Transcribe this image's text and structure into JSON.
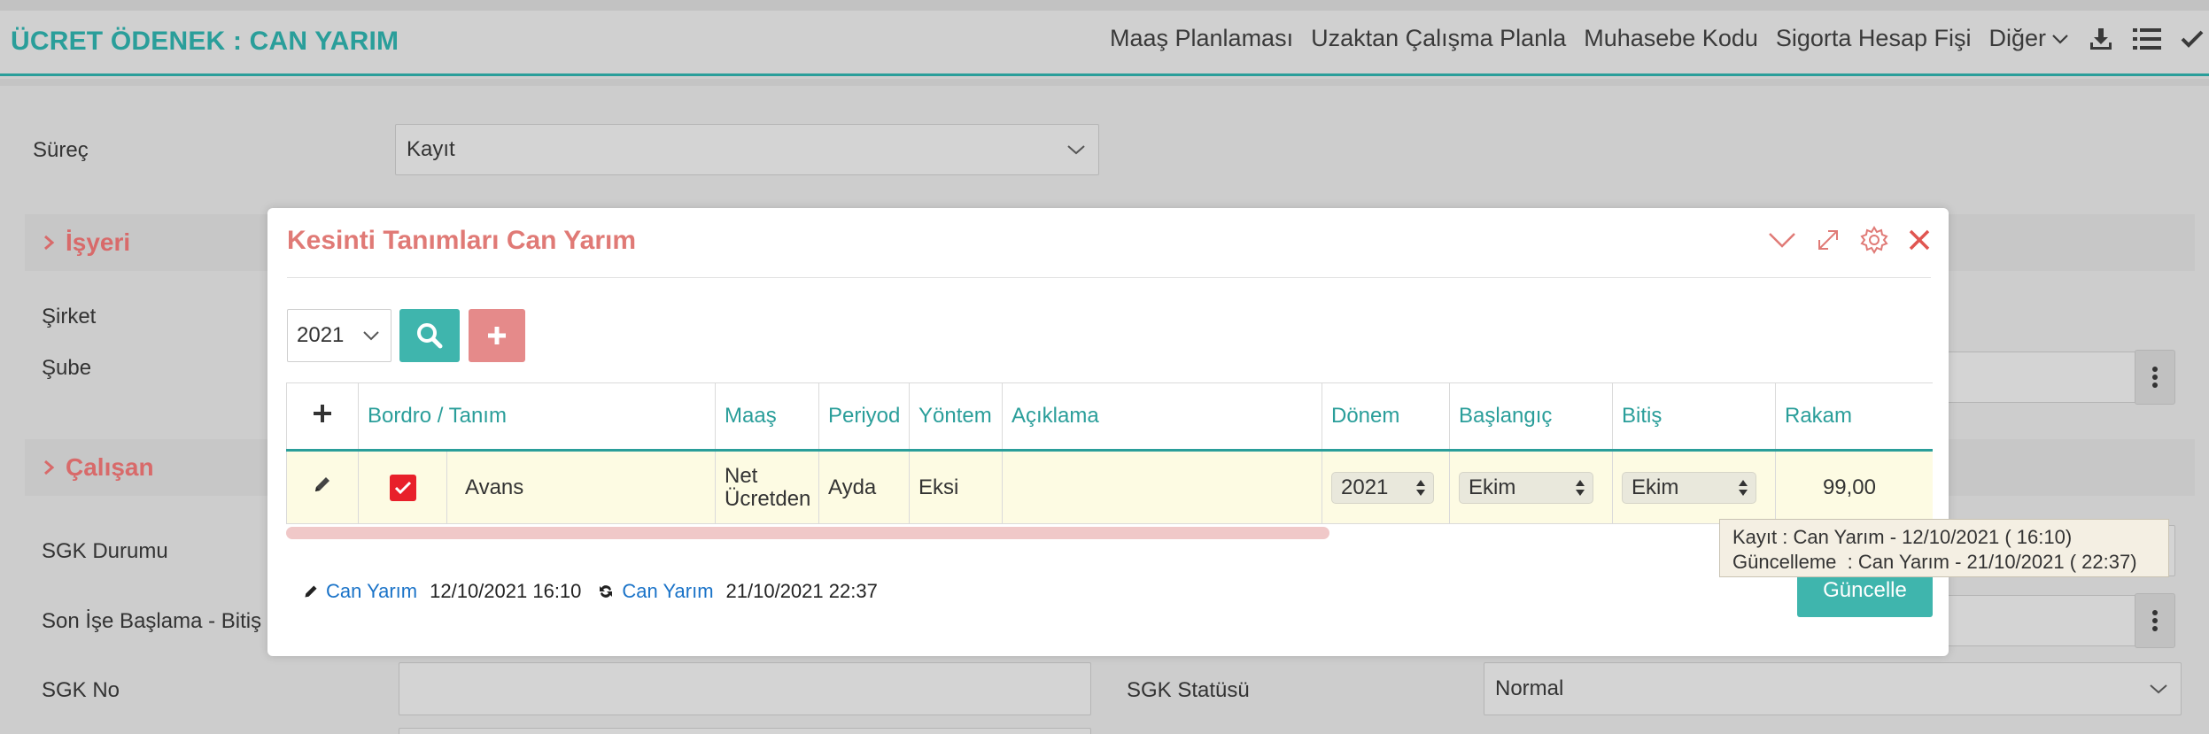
{
  "header": {
    "title": "ÜCRET ÖDENEK : CAN YARIM",
    "nav": [
      "Maaş Planlaması",
      "Uzaktan Çalışma Planla",
      "Muhasebe Kodu",
      "Sigorta Hesap Fişi"
    ],
    "more_label": "Diğer",
    "icons": [
      "download-icon",
      "list-icon",
      "check-icon"
    ]
  },
  "form": {
    "surec_label": "Süreç",
    "surec_value": "Kayıt",
    "isyeri_section": "İşyeri",
    "sirket_label": "Şirket",
    "sube_label": "Şube",
    "calisan_section": "Çalışan",
    "sgk_durumu_label": "SGK Durumu",
    "son_ise_label": "Son İşe Başlama - Bitiş",
    "sgk_no_label": "SGK No",
    "sgk_statusu_label": "SGK Statüsü",
    "sgk_statusu_value": "Normal"
  },
  "modal": {
    "title": "Kesinti Tanımları Can Yarım",
    "year": "2021",
    "columns": {
      "add": "+",
      "bordro": "Bordro / Tanım",
      "maas": "Maaş",
      "periyod": "Periyod",
      "yontem": "Yöntem",
      "aciklama": "Açıklama",
      "donem": "Dönem",
      "baslangic": "Başlangıç",
      "bitis": "Bitiş",
      "rakam": "Rakam"
    },
    "row": {
      "tanim": "Avans",
      "maas_line1": "Net",
      "maas_line2": "Ücretden",
      "periyod": "Ayda",
      "yontem": "Eksi",
      "aciklama": "",
      "donem": "2021",
      "baslangic": "Ekim",
      "bitis": "Ekim",
      "rakam": "99,00"
    },
    "footer": {
      "created_user": "Can Yarım",
      "created_date": "12/10/2021 16:10",
      "updated_user": "Can Yarım",
      "updated_date": "21/10/2021 22:37"
    },
    "update_button": "Güncelle"
  },
  "tooltip": {
    "line1": "Kayıt : Can Yarım - 12/10/2021 ( 16:10)",
    "line2": "Güncelleme  : Can Yarım - 21/10/2021 ( 22:37)"
  },
  "colors": {
    "teal": "#2a9e9a",
    "accent_red": "#e07a76",
    "row_bg": "#fdfbe3"
  }
}
